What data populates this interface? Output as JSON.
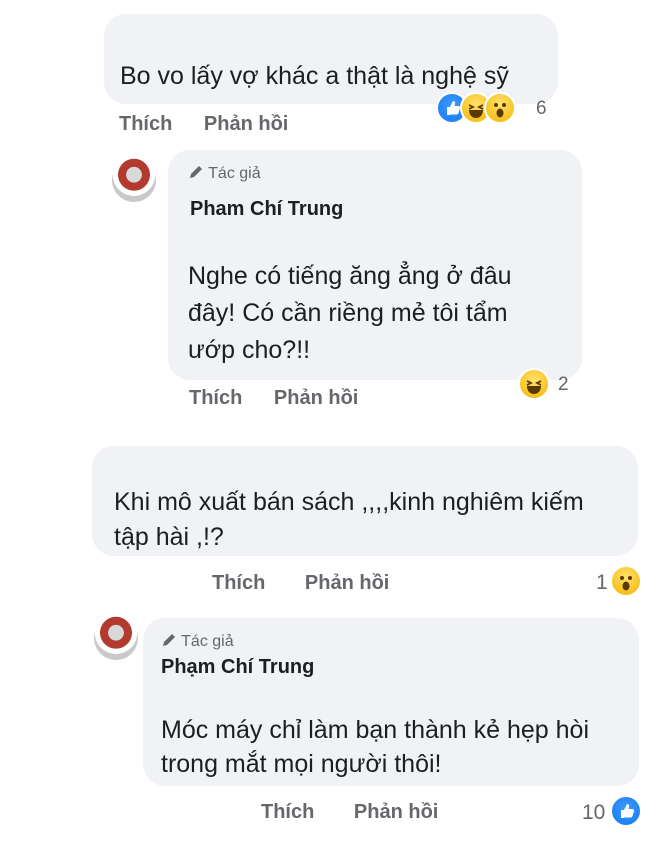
{
  "comments": [
    {
      "text_lines": [
        "Bo vo lấy vợ khác a thật là nghệ sỹ"
      ],
      "like_label": "Thích",
      "reply_label": "Phản hồi",
      "reaction_count": "6",
      "reactions": [
        "like-icon",
        "haha-icon",
        "wow-icon"
      ]
    },
    {
      "author_tag": "Tác giả",
      "author_name": "Pham Chí Trung",
      "text_lines": [
        "Nghe có tiếng ăng ẳng ở đâu",
        "đây! Có cần riềng mẻ tôi tẩm",
        "ướp cho?!!"
      ],
      "like_label": "Thích",
      "reply_label": "Phản hồi",
      "reaction_count": "2",
      "reactions": [
        "haha-icon"
      ]
    },
    {
      "text_lines": [
        "Khi mô xuất bán sách ,,,,kinh nghiêm kiếm",
        "tập hài ,!?"
      ],
      "like_label": "Thích",
      "reply_label": "Phản hồi",
      "reaction_count": "1",
      "reactions": [
        "wow-icon"
      ]
    },
    {
      "author_tag": "Tác giả",
      "author_name": "Phạm Chí Trung",
      "text_lines": [
        "Móc máy chỉ làm bạn thành kẻ hẹp hòi",
        "trong mắt mọi người thôi!"
      ],
      "like_label": "Thích",
      "reply_label": "Phản hồi",
      "reaction_count": "10",
      "reactions": [
        "like-icon"
      ]
    }
  ],
  "colors": {
    "bubble": "#f0f2f5",
    "action_text": "#65676b",
    "like_blue": "#1876f2",
    "emoji_yellow": "#f4b400"
  }
}
